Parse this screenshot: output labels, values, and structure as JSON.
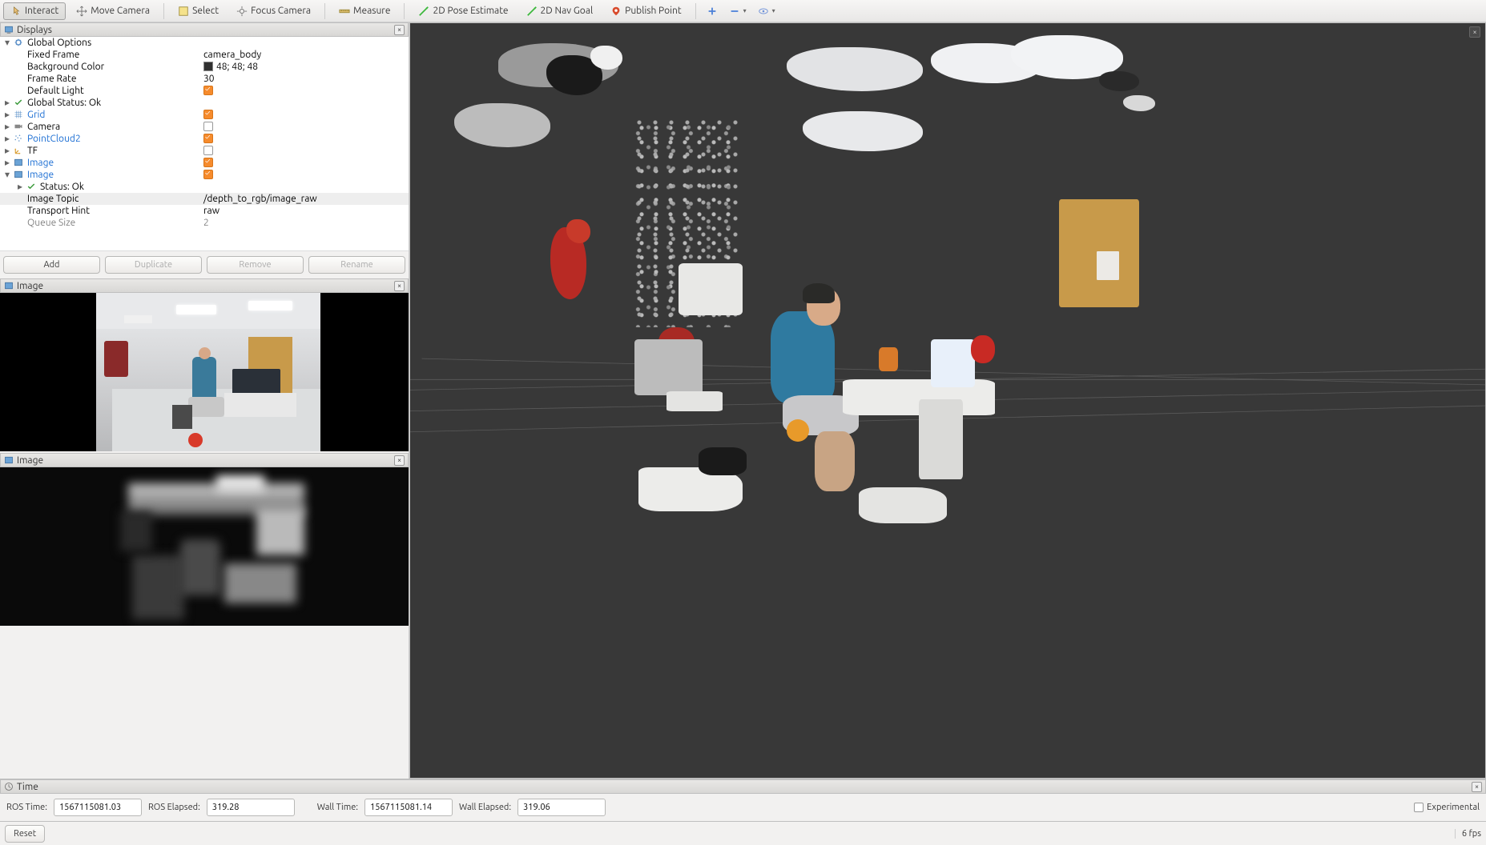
{
  "toolbar": {
    "interact": "Interact",
    "move_camera": "Move Camera",
    "select": "Select",
    "focus_camera": "Focus Camera",
    "measure": "Measure",
    "pose_estimate": "2D Pose Estimate",
    "nav_goal": "2D Nav Goal",
    "publish_point": "Publish Point"
  },
  "displays": {
    "title": "Displays",
    "tree": {
      "global_options": "Global Options",
      "fixed_frame": {
        "label": "Fixed Frame",
        "value": "camera_body"
      },
      "background_color": {
        "label": "Background Color",
        "value": "48; 48; 48"
      },
      "frame_rate": {
        "label": "Frame Rate",
        "value": "30"
      },
      "default_light": {
        "label": "Default Light"
      },
      "global_status": "Global Status: Ok",
      "grid": "Grid",
      "camera": "Camera",
      "pointcloud2": "PointCloud2",
      "tf": "TF",
      "image1": "Image",
      "image2": "Image",
      "status_ok": "Status: Ok",
      "image_topic": {
        "label": "Image Topic",
        "value": "/depth_to_rgb/image_raw"
      },
      "transport_hint": {
        "label": "Transport Hint",
        "value": "raw"
      },
      "queue_size": {
        "label": "Queue Size",
        "value": "2"
      }
    },
    "buttons": {
      "add": "Add",
      "duplicate": "Duplicate",
      "remove": "Remove",
      "rename": "Rename"
    }
  },
  "image_panel1": {
    "title": "Image"
  },
  "image_panel2": {
    "title": "Image"
  },
  "time": {
    "title": "Time",
    "ros_time_label": "ROS Time:",
    "ros_time_value": "1567115081.03",
    "ros_elapsed_label": "ROS Elapsed:",
    "ros_elapsed_value": "319.28",
    "wall_time_label": "Wall Time:",
    "wall_time_value": "1567115081.14",
    "wall_elapsed_label": "Wall Elapsed:",
    "wall_elapsed_value": "319.06",
    "experimental": "Experimental"
  },
  "bottom": {
    "reset": "Reset",
    "fps": "6 fps"
  }
}
